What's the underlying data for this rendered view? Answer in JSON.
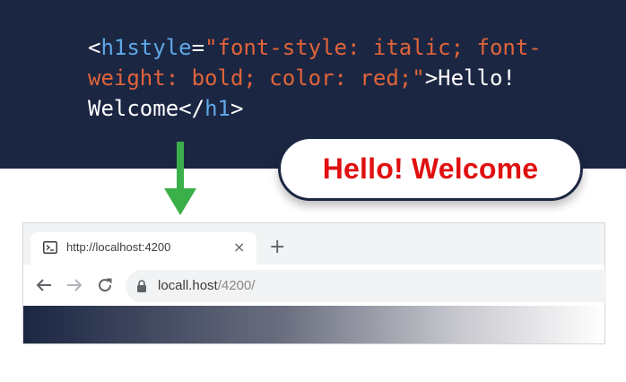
{
  "code": {
    "line1": {
      "open": "<",
      "tag": "h1style",
      "eq": "=",
      "value": "\"font-style: italic; font-"
    },
    "line2": {
      "value": "weight: bold; color: red;\"",
      "close": ">",
      "text": "Hello!"
    },
    "line3": {
      "text": "Welcome",
      "open": "</",
      "tag": "h1",
      "close": ">"
    }
  },
  "bubble": {
    "text": "Hello! Welcome"
  },
  "browser": {
    "tab_title": "http://localhost:4200",
    "tab_close": "×",
    "new_tab": "+",
    "url_host": "locall.host",
    "url_path": "/4200/"
  },
  "colors": {
    "background_dark": "#1b2642",
    "arrow": "#3bb04a",
    "heading_red": "#e01010",
    "code_tag": "#5ea8e6",
    "code_string": "#e0643a"
  },
  "icons": [
    "terminal-icon",
    "close-icon",
    "plus-icon",
    "back-arrow-icon",
    "forward-arrow-icon",
    "reload-icon",
    "lock-icon",
    "down-arrow-icon"
  ]
}
